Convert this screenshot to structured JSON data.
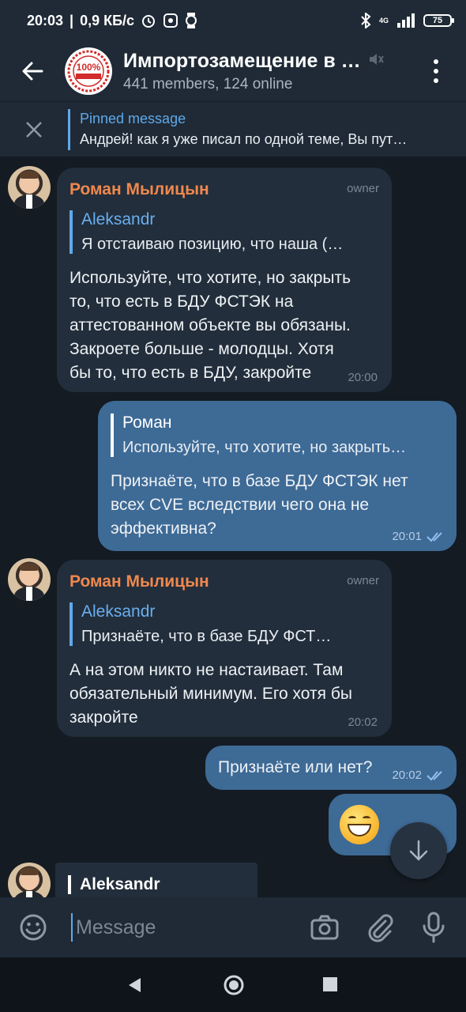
{
  "status_bar": {
    "time": "20:03",
    "speed": "0,9 КБ/с",
    "network": "4G",
    "battery": "75"
  },
  "header": {
    "title": "Импортозамещение в …",
    "members": "441 members, ",
    "online": "124 online",
    "avatar_text": "100%"
  },
  "pinned": {
    "label": "Pinned message",
    "text": "Андрей! как я уже писал по одной теме, Вы пут…"
  },
  "messages": [
    {
      "direction": "in",
      "sender": "Роман Мылицын",
      "role": "owner",
      "reply_name": "Aleksandr",
      "reply_text": "Я отстаиваю позицию, что наша (…",
      "lines": [
        "Используйте, что хотите, но закрыть",
        "то, что есть в БДУ ФСТЭК на",
        "аттестованном объекте вы обязаны.",
        "Закроете больше - молодцы. Хотя",
        "бы то, что есть в БДУ, закройте"
      ],
      "time": "20:00"
    },
    {
      "direction": "out",
      "reply_name": "Роман",
      "reply_text": "Используйте, что хотите, но закрыть…",
      "lines": [
        "Признаёте, что в базе БДУ ФСТЭК нет",
        "всех CVE  вследствии чего она не",
        "эффективна?"
      ],
      "time": "20:01"
    },
    {
      "direction": "in",
      "sender": "Роман Мылицын",
      "role": "owner",
      "reply_name": "Aleksandr",
      "reply_text": "Признаёте, что в базе БДУ ФСТ…",
      "lines": [
        "А на этом никто не настаивает. Там",
        "обязательный минимум. Его хотя бы",
        "закройте"
      ],
      "time": "20:02"
    },
    {
      "direction": "out",
      "text": "Признаёте или нет?",
      "time": "20:02"
    },
    {
      "direction": "out",
      "emoji": "grinning-face"
    },
    {
      "direction": "in",
      "reply_name": "Aleksandr"
    }
  ],
  "input": {
    "placeholder": "Message"
  }
}
